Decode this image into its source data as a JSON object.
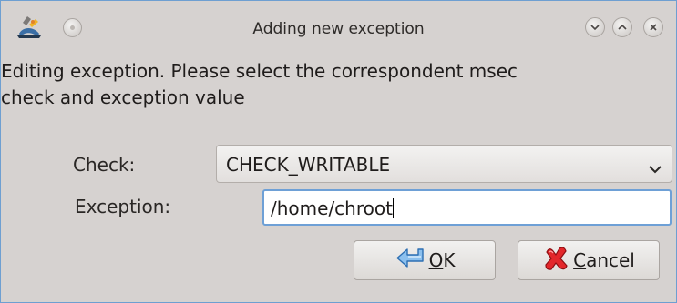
{
  "window": {
    "title": "Adding new exception",
    "icons": {
      "app": "msec-app-icon",
      "pin": "pin-icon",
      "minimize": "chevron-down-icon",
      "maximize": "chevron-up-icon",
      "close": "close-icon"
    }
  },
  "message": {
    "line1": "Editing exception. Please select the correspondent msec",
    "line2": "check and exception value"
  },
  "form": {
    "check_label": "Check:",
    "check_value": "CHECK_WRITABLE",
    "exception_label": "Exception:",
    "exception_value": "/home/chroot"
  },
  "buttons": {
    "ok": {
      "mnemonic": "O",
      "rest": "K",
      "icon": "ok-arrow-icon"
    },
    "cancel": {
      "mnemonic": "C",
      "rest": "ancel",
      "icon": "cancel-x-icon"
    }
  },
  "colors": {
    "window_bg": "#d6d2d0",
    "focus_border": "#6ea0d6",
    "frame_border": "#6e9fd1"
  }
}
